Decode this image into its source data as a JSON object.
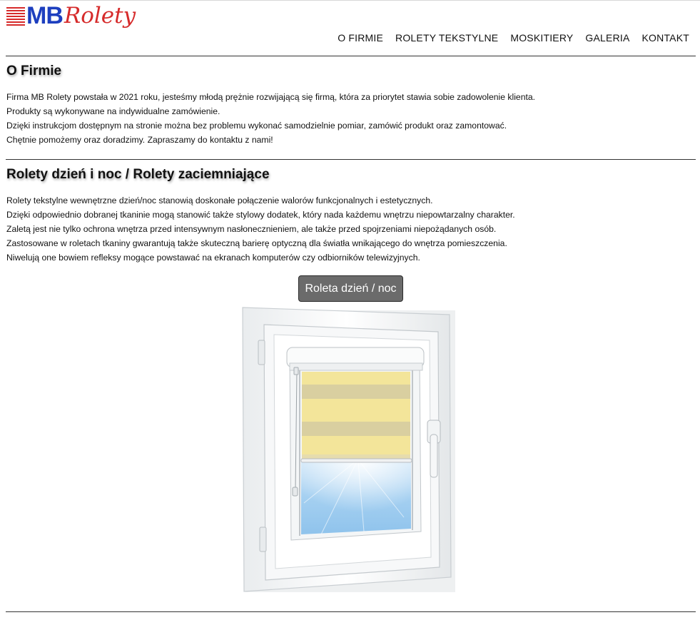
{
  "logo": {
    "brand_mb": "MB",
    "brand_rolety": "Rolety"
  },
  "nav": {
    "items": [
      {
        "label": "O FIRMIE"
      },
      {
        "label": "ROLETY TEKSTYLNE"
      },
      {
        "label": "MOSKITIERY"
      },
      {
        "label": "GALERIA"
      },
      {
        "label": "KONTAKT"
      }
    ]
  },
  "about": {
    "title": "O Firmie",
    "lines": [
      "Firma MB Rolety powstała w 2021 roku, jesteśmy młodą prężnie rozwijającą się firmą, która za priorytet stawia sobie zadowolenie klienta.",
      "Produkty są wykonywane na indywidualne zamówienie.",
      "Dzięki instrukcjom dostępnym na stronie można bez problemu wykonać samodzielnie pomiar, zamówić produkt oraz zamontować.",
      "Chętnie pomożemy oraz doradzimy. Zapraszamy do kontaktu z nami!"
    ]
  },
  "daynight": {
    "title": "Rolety dzień i noc / Rolety zaciemniające",
    "lines": [
      "Rolety tekstylne wewnętrzne dzień/noc stanowią doskonałe połączenie walorów funkcjonalnych i estetycznych.",
      "Dzięki odpowiednio dobranej tkaninie mogą stanowić także stylowy dodatek, który nada każdemu wnętrzu niepowtarzalny charakter.",
      "Zaletą jest nie tylko ochrona wnętrza przed intensywnym nasłonecznieniem, ale także przed spojrzeniami niepożądanych osób.",
      "Zastosowane w roletach tkaniny gwarantują także skuteczną barierę optyczną dla światła wnikającego do wnętrza pomieszczenia.",
      "Niwelują one bowiem refleksy mogące powstawać na ekranach komputerów czy odbiorników telewizyjnych."
    ],
    "button_label": "Roleta dzień / noc"
  },
  "colors": {
    "brand_blue": "#1d3fbf",
    "brand_red": "#d62b2b",
    "button_bg": "#6b6b6b",
    "blind_yellow": "#f3e59a",
    "blind_stripe": "#d9cfa0",
    "glass_blue": "#9ccbef"
  },
  "icons": {
    "logo_mark": "red-stripes-icon"
  }
}
